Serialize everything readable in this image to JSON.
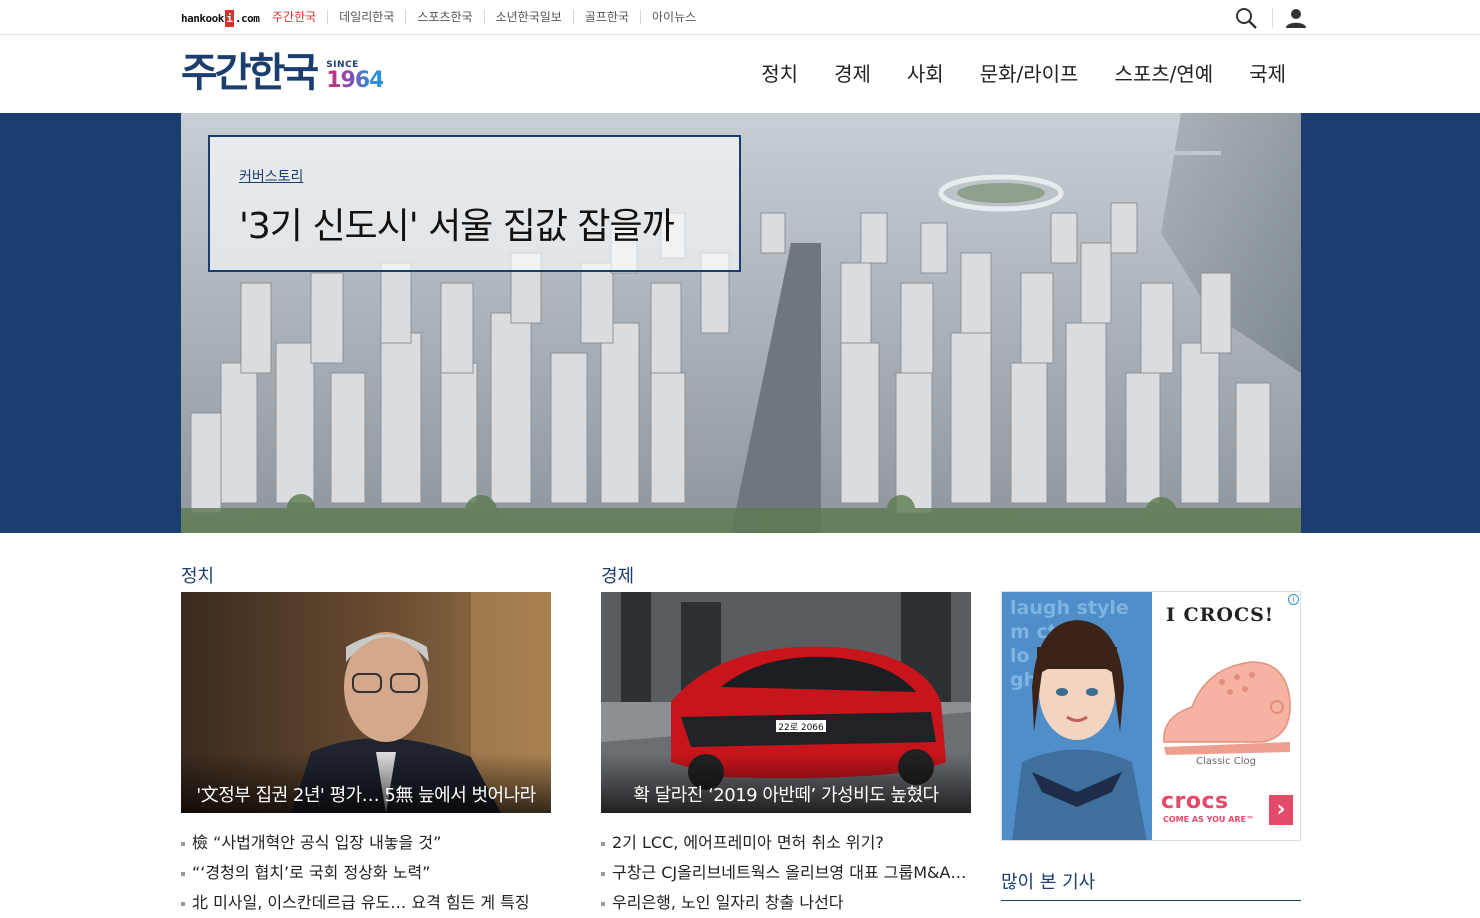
{
  "topbar": {
    "logo_text": "hankook",
    "logo_i": "i",
    "logo_suffix": ".com",
    "links": [
      "주간한국",
      "데일리한국",
      "스포츠한국",
      "소년한국일보",
      "골프한국",
      "아이뉴스"
    ],
    "active_index": 0,
    "icons": [
      "search-icon",
      "user-icon"
    ]
  },
  "header": {
    "brand_name": "주간한국",
    "since_label": "SINCE",
    "since_year": "1964",
    "nav": [
      "정치",
      "경제",
      "사회",
      "문화/라이프",
      "스포츠/연예",
      "국제"
    ]
  },
  "hero": {
    "kicker": "커버스토리",
    "headline": "'3기 신도시' 서울 집값 잡을까"
  },
  "politics": {
    "section_title": "정치",
    "card_caption": "'文정부 집권 2년' 평가… 5無 늪에서 벗어나라",
    "items": [
      "檢 “사법개혁안 공식 입장 내놓을 것”",
      "“‘경청의 협치’로 국회 정상화 노력”",
      "北 미사일, 이스칸데르급 유도… 요격 힘든 게 특징"
    ]
  },
  "economy": {
    "section_title": "경제",
    "card_caption": "확 달라진 ‘2019 아반떼’ 가성비도 높혔다",
    "car_plate": "22로 2066",
    "items": [
      "2기 LCC, 에어프레미아 면허 취소 위기?",
      "구창근 CJ올리브네트웍스 올리브영 대표 그룹M&A 주도",
      "우리은행, 노인 일자리 창출 나선다"
    ]
  },
  "ad": {
    "tagline_words": [
      "laugh",
      "style",
      "m",
      "ct",
      "lo",
      "c",
      "gh"
    ],
    "title": "I CROCS!",
    "model": "Classic Clog",
    "brand": "crocs",
    "sub": "COME AS YOU ARE™",
    "info": "i",
    "arrow": "›"
  },
  "sidebar": {
    "popular_title": "많이 본 기사"
  },
  "colors": {
    "navy": "#1c3d6f",
    "accent_red": "#d8322c",
    "ad_pink": "#e54a6a"
  }
}
